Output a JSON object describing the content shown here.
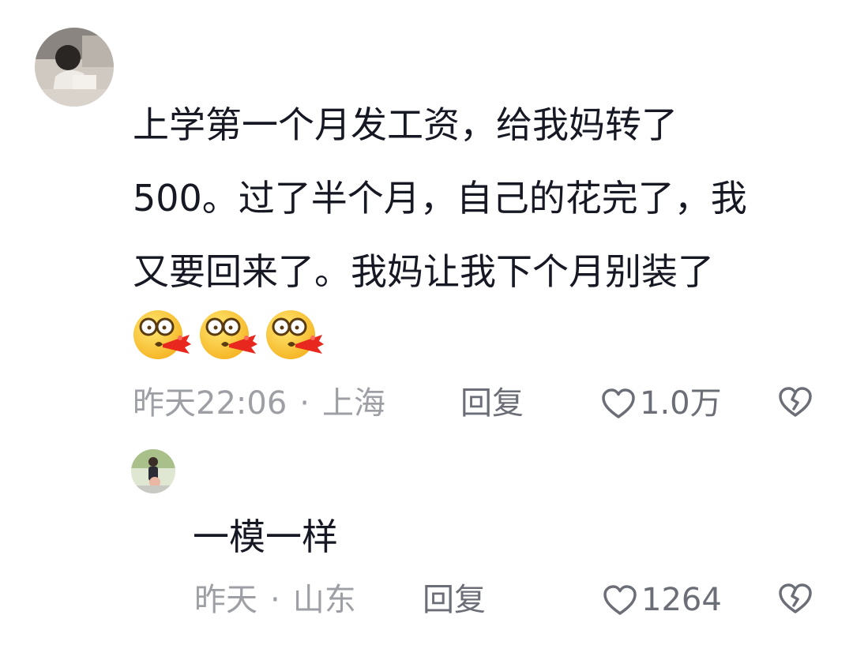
{
  "comment": {
    "text": "上学第一个月发工资，给我妈转了\n500。过了半个月，自己的花完了，我\n又要回来了。我妈让我下个月别装了",
    "emojis": [
      "spitting-blood-emoji",
      "spitting-blood-emoji",
      "spitting-blood-emoji"
    ],
    "time": "昨天22:06",
    "separator": "·",
    "location": "上海",
    "reply_label": "回复",
    "like_count": "1.0万",
    "like_icon": "heart-outline-icon",
    "dislike_icon": "broken-heart-icon"
  },
  "reply": {
    "text": "一模一样",
    "time": "昨天",
    "separator": "·",
    "location": "山东",
    "reply_label": "回复",
    "like_count": "1264",
    "like_icon": "heart-outline-icon",
    "dislike_icon": "broken-heart-icon"
  },
  "colors": {
    "text_primary": "#161823",
    "text_meta": "#9d9fa5",
    "text_action": "#6b6e76"
  }
}
